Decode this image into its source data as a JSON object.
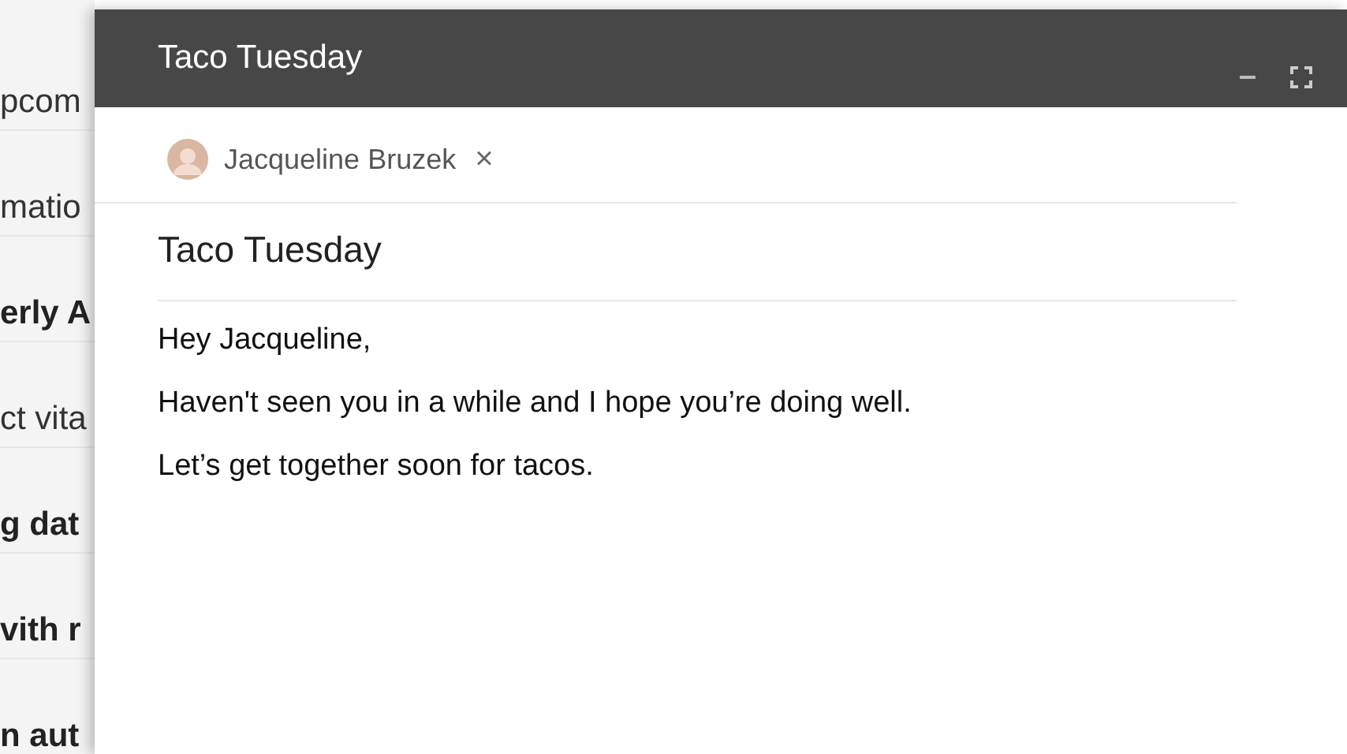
{
  "inbox_rows": [
    {
      "text": "pcom",
      "unread": false
    },
    {
      "text": "matio",
      "unread": false
    },
    {
      "text": "erly A",
      "unread": true
    },
    {
      "text": "ct vita",
      "unread": false
    },
    {
      "text": "g dat",
      "unread": true
    },
    {
      "text": "vith r",
      "unread": true
    },
    {
      "text": "n aut",
      "unread": true
    }
  ],
  "compose": {
    "title": "Taco Tuesday",
    "recipients": [
      {
        "name": "Jacqueline Bruzek",
        "remove": "×"
      }
    ],
    "subject": "Taco Tuesday",
    "body": [
      "Hey Jacqueline,",
      "Haven't seen you in a while and I hope you’re doing well.",
      "Let’s get together soon for tacos."
    ]
  }
}
